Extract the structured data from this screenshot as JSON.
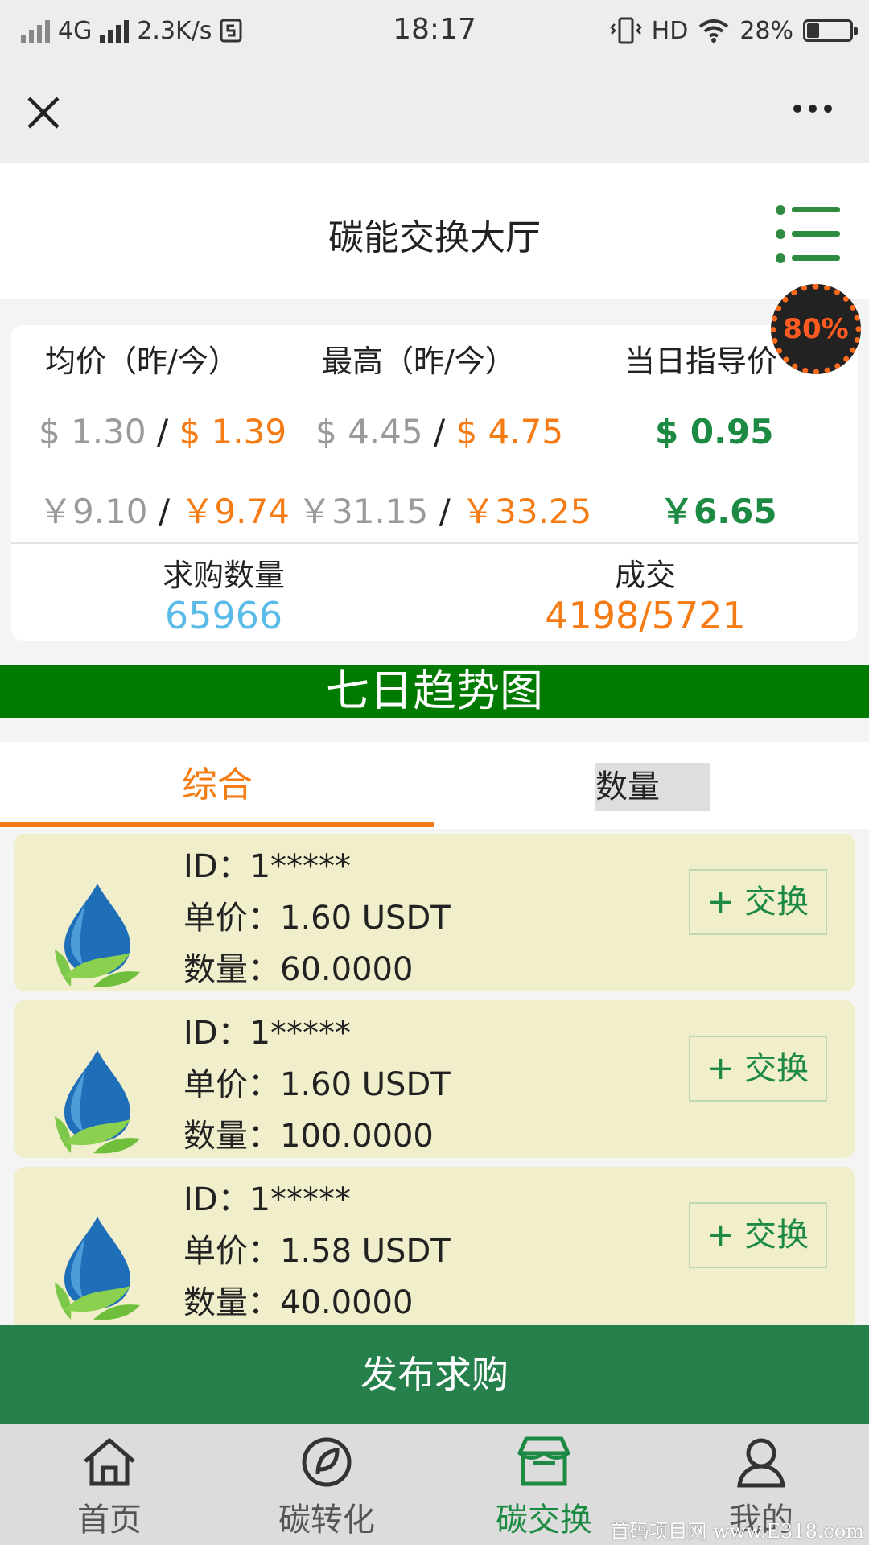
{
  "status_bar": {
    "network": "4G",
    "speed": "2.3K/s",
    "time": "18:17",
    "hd": "HD",
    "battery": "28%",
    "battery_level": 0.28
  },
  "header": {
    "title": "碳能交换大厅"
  },
  "badge": {
    "text": "80%"
  },
  "stats": {
    "columns": [
      {
        "header": "均价（昨/今）",
        "usd_yesterday": "$ 1.30",
        "usd_today": "$ 1.39",
        "cny_yesterday": "￥9.10",
        "cny_today": "￥9.74"
      },
      {
        "header": "最高（昨/今）",
        "usd_yesterday": "$ 4.45",
        "usd_today": "$ 4.75",
        "cny_yesterday": "￥31.15",
        "cny_today": "￥33.25"
      },
      {
        "header": "当日指导价",
        "usd": "$ 0.95",
        "cny": "￥6.65"
      }
    ],
    "separator": "/",
    "summary": [
      {
        "label": "求购数量",
        "value": "65966"
      },
      {
        "label": "成交",
        "value": "4198/5721"
      }
    ]
  },
  "trend_banner": "七日趋势图",
  "tabs": [
    {
      "label": "综合",
      "active": true
    },
    {
      "label": "数量",
      "active": false
    }
  ],
  "list": {
    "id_label": "ID：",
    "price_label": "单价：",
    "qty_label": "数量：",
    "button_label": "+ 交换",
    "items": [
      {
        "id": "1*****",
        "price": "1.60 USDT",
        "qty": "60.0000"
      },
      {
        "id": "1*****",
        "price": "1.60 USDT",
        "qty": "100.0000"
      },
      {
        "id": "1*****",
        "price": "1.58 USDT",
        "qty": "40.0000"
      }
    ]
  },
  "publish_button": "发布求购",
  "tabbar": [
    {
      "label": "首页",
      "icon": "home-icon",
      "active": false
    },
    {
      "label": "碳转化",
      "icon": "leaf-circle-icon",
      "active": false
    },
    {
      "label": "碳交换",
      "icon": "exchange-box-icon",
      "active": true
    },
    {
      "label": "我的",
      "icon": "user-icon",
      "active": false
    }
  ],
  "watermark": "首码项目网 www.E318.com",
  "colors": {
    "accent_orange": "#f57c14",
    "green": "#1c8a43",
    "banner_green": "#007b00",
    "sky": "#5bbbe8"
  }
}
